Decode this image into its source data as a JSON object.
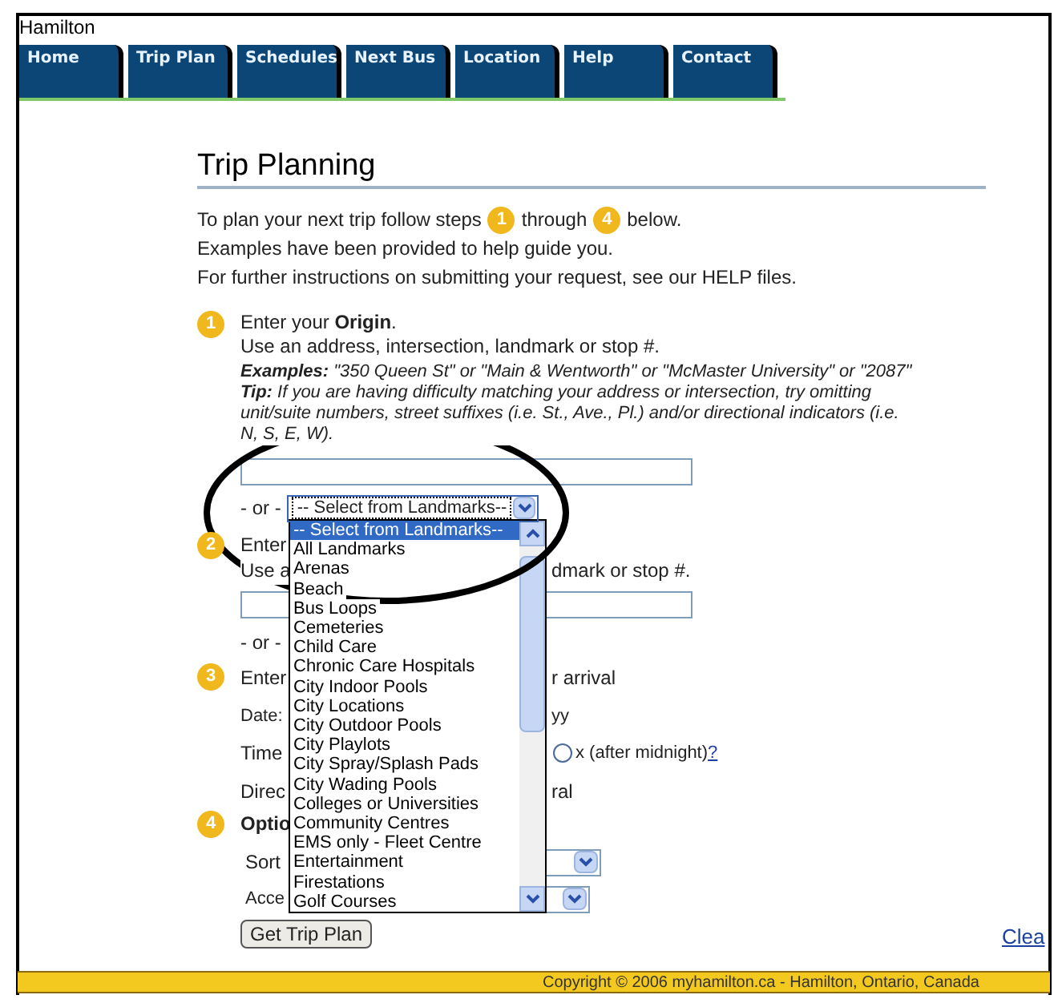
{
  "site_title": "Hamilton",
  "tabs": [
    {
      "label": "Home"
    },
    {
      "label": "Trip Plan"
    },
    {
      "label": "Schedules"
    },
    {
      "label": "Next Bus"
    },
    {
      "label": "Location"
    },
    {
      "label": "Help"
    },
    {
      "label": "Contact"
    }
  ],
  "page_title": "Trip Planning",
  "intro": {
    "before": "To plan your next trip follow steps",
    "step_from": "1",
    "middle": "through",
    "step_to": "4",
    "after": "below."
  },
  "intro_lines": [
    "Examples have been provided to help guide you.",
    "For further instructions on submitting your request, see our HELP files."
  ],
  "step1": {
    "number": "1",
    "heading": "Enter your **Origin**.",
    "subheading": "Use an address, intersection, landmark or stop #.",
    "examples": "**Examples:** \"350 Queen St\" or \"Main & Wentworth\" or \"McMaster University\" or \"2087\"",
    "tip": "**Tip:** If you are having difficulty matching your address or intersection, try omitting unit/suite numbers, street suffixes (i.e. St., Ave., Pl.) and/or directional indicators (i.e. N, S, E, W)."
  },
  "or_label": "- or -",
  "landmark_select": {
    "value": "-- Select from Landmarks--",
    "expanded": true,
    "options": [
      {
        "label": "-- Select from Landmarks--",
        "selected": true
      },
      {
        "label": "All Landmarks",
        "selected": false
      },
      {
        "label": "Arenas",
        "selected": false
      },
      {
        "label": "Beach",
        "selected": false
      },
      {
        "label": "Bus Loops",
        "selected": false
      },
      {
        "label": "Cemeteries",
        "selected": false
      },
      {
        "label": "Child Care",
        "selected": false
      },
      {
        "label": "Chronic Care Hospitals",
        "selected": false
      },
      {
        "label": "City Indoor Pools",
        "selected": false
      },
      {
        "label": "City Locations",
        "selected": false
      },
      {
        "label": "City Outdoor Pools",
        "selected": false
      },
      {
        "label": "City Playlots",
        "selected": false
      },
      {
        "label": "City Spray/Splash Pads",
        "selected": false
      },
      {
        "label": "City Wading Pools",
        "selected": false
      },
      {
        "label": "Colleges or Universities",
        "selected": false
      },
      {
        "label": "Community Centres",
        "selected": false
      },
      {
        "label": "EMS only - Fleet Centre",
        "selected": false
      },
      {
        "label": "Entertainment",
        "selected": false
      },
      {
        "label": "Firestations",
        "selected": false
      },
      {
        "label": "Golf Courses",
        "selected": false
      }
    ]
  },
  "step2": {
    "number": "2",
    "line1": "Enter",
    "line2_left": "Use a",
    "line2_right": "dmark or stop #."
  },
  "or_label_2": "- or -",
  "step3": {
    "number": "3",
    "left": "Enter",
    "right": "r arrival"
  },
  "date": {
    "left": "Date:",
    "right": "yy"
  },
  "time": {
    "left": "Time",
    "radio_selected": false,
    "radio_label": "x (after midnight)",
    "help_link": "?"
  },
  "direction": {
    "left": "Direc",
    "right": "ral"
  },
  "step4": {
    "number": "4",
    "label": "Optio"
  },
  "sort": {
    "label": "Sort"
  },
  "access": {
    "label": "Acce"
  },
  "submit_button": "Get Trip Plan",
  "clear_link": "Clea",
  "footer": "Copyright © 2006 myhamilton.ca - Hamilton, Ontario, Canada"
}
